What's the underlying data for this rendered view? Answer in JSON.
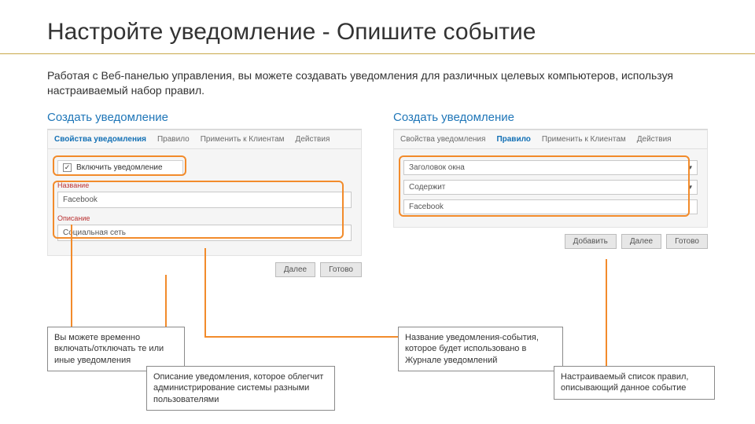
{
  "title": "Настройте уведомление - Опишите событие",
  "intro": "Работая с Веб-панелью управления, вы можете создавать уведомления для различных целевых компьютеров, используя настраиваемый набор правил.",
  "leftPanel": {
    "heading": "Создать уведомление",
    "tabs": [
      "Свойства уведомления",
      "Правило",
      "Применить к Клиентам",
      "Действия"
    ],
    "activeTab": 0,
    "enableLabel": "Включить уведомление",
    "nameLabel": "Название",
    "nameValue": "Facebook",
    "descLabel": "Описание",
    "descValue": "Социальная сеть",
    "buttons": [
      "Далее",
      "Готово"
    ]
  },
  "rightPanel": {
    "heading": "Создать уведомление",
    "tabs": [
      "Свойства уведомления",
      "Правило",
      "Применить к Клиентам",
      "Действия"
    ],
    "activeTab": 1,
    "selects": [
      "Заголовок окна",
      "Содержит",
      "Facebook"
    ],
    "buttons": [
      "Добавить",
      "Далее",
      "Готово"
    ]
  },
  "callouts": {
    "c1": "Вы можете временно включать/отключать те или иные уведомления",
    "c2": "Описание уведомления, которое облегчит администрирование системы разными пользователями",
    "c3": "Название уведомления-события, которое будет использовано в Журнале уведомлений",
    "c4": "Настраиваемый список правил, описывающий данное событие"
  }
}
